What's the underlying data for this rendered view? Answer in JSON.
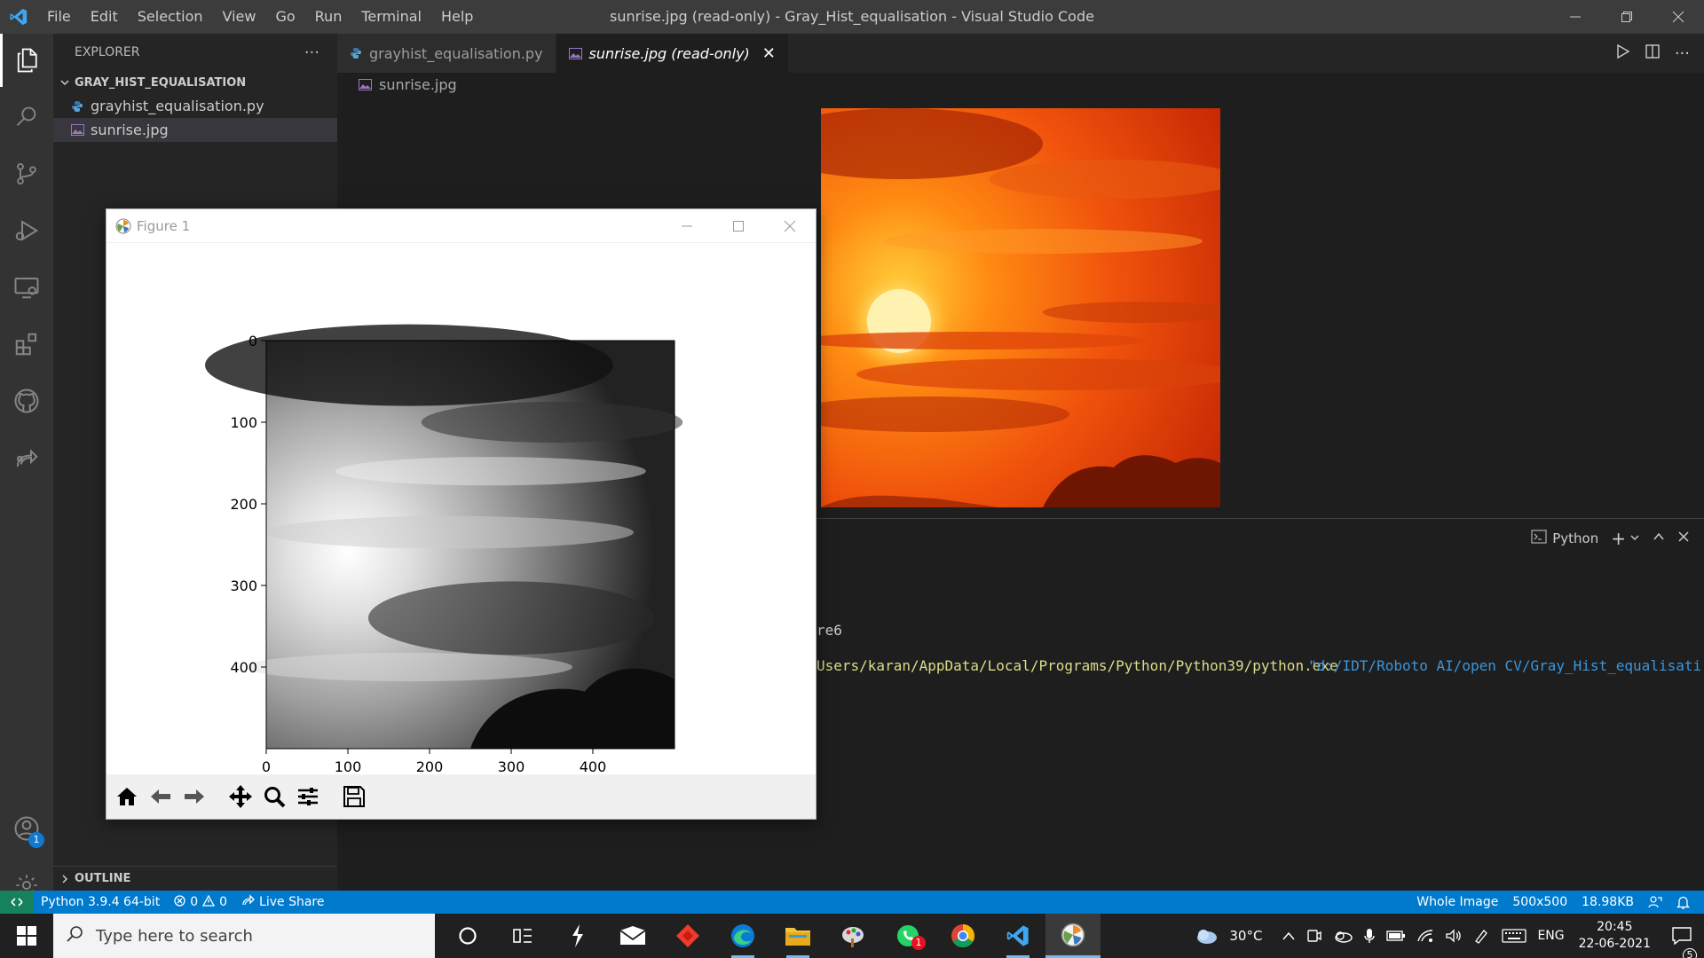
{
  "window": {
    "title": "sunrise.jpg (read-only) - Gray_Hist_equalisation - Visual Studio Code",
    "menu": [
      "File",
      "Edit",
      "Selection",
      "View",
      "Go",
      "Run",
      "Terminal",
      "Help"
    ]
  },
  "sidebar": {
    "header": "EXPLORER",
    "more": "···",
    "folder": "GRAY_HIST_EQUALISATION",
    "files": [
      {
        "name": "grayhist_equalisation.py",
        "icon": "python-file-icon"
      },
      {
        "name": "sunrise.jpg",
        "icon": "image-file-icon",
        "selected": true
      }
    ],
    "outline": "OUTLINE"
  },
  "activity_bar": {
    "accounts_badge": "1"
  },
  "editor": {
    "tabs": [
      {
        "label": "grayhist_equalisation.py",
        "active": false
      },
      {
        "label": "sunrise.jpg (read-only)",
        "active": true
      }
    ],
    "breadcrumb": "sunrise.jpg"
  },
  "panel": {
    "terminal_name": "Python",
    "lines": [
      {
        "text": "re6",
        "color": "#cccccc"
      },
      {
        "text": "Users/karan/AppData/Local/Programs/Python/Python39/python.exe",
        "color": "#dcdc8b"
      },
      {
        "text": "\"d:/IDT/Roboto AI/open CV/Gray_Hist_equalisati",
        "color": "#3a96dd"
      }
    ]
  },
  "figure": {
    "title": "Figure 1"
  },
  "chart_data": {
    "type": "heatmap",
    "title": "",
    "xlabel": "",
    "ylabel": "",
    "x_ticks": [
      0,
      100,
      200,
      300,
      400
    ],
    "y_ticks": [
      0,
      100,
      200,
      300,
      400
    ],
    "xlim": [
      0,
      500
    ],
    "ylim": [
      500,
      0
    ],
    "colormap": "gray"
  },
  "statusbar": {
    "python": "Python 3.9.4 64-bit",
    "errors": "0",
    "warnings": "0",
    "live_share": "Live Share",
    "whole_image": "Whole Image",
    "dimensions": "500x500",
    "size": "18.98KB"
  },
  "taskbar": {
    "search_placeholder": "Type here to search",
    "weather": "30°C",
    "language": "ENG",
    "time": "20:45",
    "date": "22-06-2021",
    "notifications": "5",
    "whatsapp_badge": "1"
  },
  "colors": {
    "accent": "#007acc",
    "remote": "#16825d",
    "editor_bg": "#1e1e1e"
  }
}
